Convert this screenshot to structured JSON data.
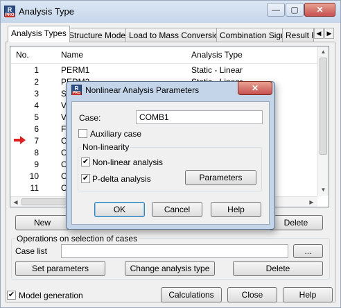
{
  "window": {
    "title": "Analysis Type",
    "app_icon": "R",
    "app_icon_sub": "PRO",
    "controls": {
      "minimize": "—",
      "maximize": "▢",
      "close": "✕"
    }
  },
  "tabs": [
    {
      "label": "Analysis Types",
      "active": true
    },
    {
      "label": "Structure Model",
      "active": false
    },
    {
      "label": "Load to Mass Conversion",
      "active": false
    },
    {
      "label": "Combination Sign",
      "active": false
    },
    {
      "label": "Result F",
      "active": false
    }
  ],
  "tab_arrows": {
    "left": "◀",
    "right": "▶"
  },
  "list": {
    "headers": {
      "no": "No.",
      "name": "Name",
      "type": "Analysis Type"
    },
    "rows": [
      {
        "no": "1",
        "name": "PERM1",
        "type": "Static - Linear"
      },
      {
        "no": "2",
        "name": "PERM2",
        "type": "Static - Linear"
      },
      {
        "no": "3",
        "name": "S",
        "type": ""
      },
      {
        "no": "4",
        "name": "V",
        "type": ""
      },
      {
        "no": "5",
        "name": "V",
        "type": ""
      },
      {
        "no": "6",
        "name": "F",
        "type": ""
      },
      {
        "no": "7",
        "name": "C",
        "type": ""
      },
      {
        "no": "8",
        "name": "C",
        "type": ""
      },
      {
        "no": "9",
        "name": "C",
        "type": ""
      },
      {
        "no": "10",
        "name": "C",
        "type": ""
      },
      {
        "no": "11",
        "name": "C",
        "type": ""
      }
    ],
    "selected_marker_row": "7",
    "marker_color": "#e02020"
  },
  "list_buttons": {
    "new": "New",
    "delete": "Delete"
  },
  "operations": {
    "group_label": "Operations on selection of cases",
    "case_list_label": "Case list",
    "case_list_value": "",
    "browse": "...",
    "set_parameters": "Set parameters",
    "change_type": "Change analysis type",
    "delete": "Delete"
  },
  "footer": {
    "model_generation": "Model generation",
    "model_generation_checked": true,
    "calculations": "Calculations",
    "close": "Close",
    "help": "Help"
  },
  "dialog": {
    "title": "Nonlinear Analysis Parameters",
    "close": "✕",
    "case_label": "Case:",
    "case_value": "COMB1",
    "auxiliary_case": "Auxiliary case",
    "auxiliary_checked": false,
    "nonlinearity_group": "Non-linearity",
    "nonlinear_analysis": "Non-linear analysis",
    "nonlinear_checked": true,
    "pdelta_analysis": "P-delta analysis",
    "pdelta_checked": true,
    "parameters": "Parameters",
    "ok": "OK",
    "cancel": "Cancel",
    "help": "Help"
  },
  "check_glyph": "✔"
}
